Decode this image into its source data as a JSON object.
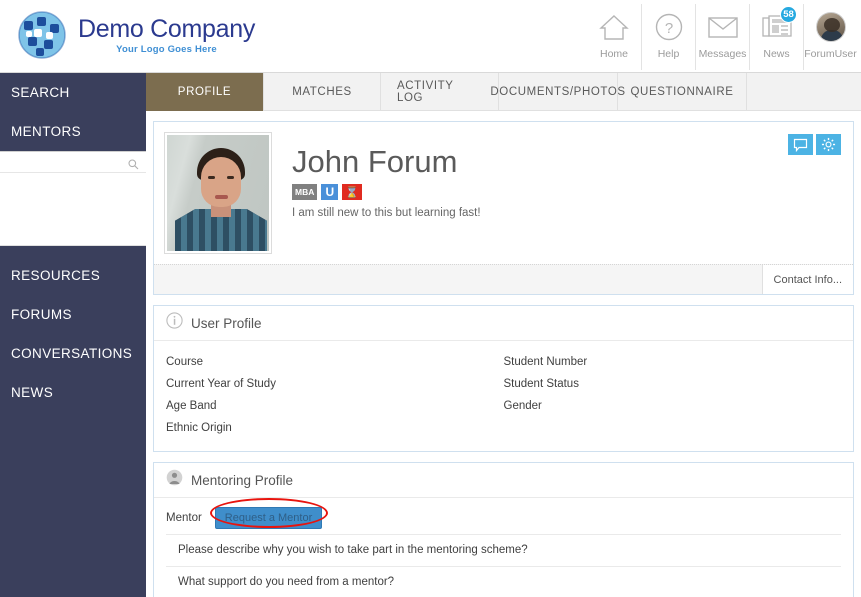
{
  "brand": {
    "title": "Demo Company",
    "subtitle": "Your Logo Goes Here",
    "logo_icon": "puzzle-globe-icon",
    "title_color": "#2b3a8f",
    "subtitle_color": "#3f8fd4"
  },
  "topnav": {
    "items": [
      {
        "label": "Home",
        "icon": "home-icon"
      },
      {
        "label": "Help",
        "icon": "help-question-icon"
      },
      {
        "label": "Messages",
        "icon": "envelope-icon"
      },
      {
        "label": "News",
        "icon": "newspaper-icon",
        "badge": "58"
      },
      {
        "label": "ForumUser",
        "icon": "user-avatar-icon"
      }
    ],
    "badge_color": "#26a9e0"
  },
  "sidebar": {
    "background_color": "#3a3f5c",
    "items_top": [
      {
        "label": "SEARCH"
      },
      {
        "label": "MENTORS"
      }
    ],
    "search": {
      "value": "",
      "placeholder": "",
      "icon": "search-icon"
    },
    "items_bottom": [
      {
        "label": "RESOURCES"
      },
      {
        "label": "FORUMS"
      },
      {
        "label": "CONVERSATIONS"
      },
      {
        "label": "NEWS"
      }
    ]
  },
  "tabs": {
    "active_color": "#7c6d4f",
    "items": [
      {
        "label": "PROFILE",
        "active": true
      },
      {
        "label": "MATCHES",
        "active": false
      },
      {
        "label": "ACTIVITY LOG",
        "active": false
      },
      {
        "label": "DOCUMENTS/PHOTOS",
        "active": false
      },
      {
        "label": "QUESTIONNAIRE",
        "active": false
      }
    ]
  },
  "profile": {
    "photo_icon": "user-photo",
    "name": "John Forum",
    "badges": [
      {
        "label": "MBA",
        "color": "#808080"
      },
      {
        "label": "U",
        "color": "#4a90d9"
      },
      {
        "label": "⌛",
        "color": "#e02b20"
      }
    ],
    "tagline": "I am still new to this but learning fast!",
    "actions": [
      {
        "icon": "chat-bubble-icon"
      },
      {
        "icon": "gear-icon"
      }
    ],
    "contact_tab_label": "Contact Info..."
  },
  "user_profile": {
    "section_title": "User Profile",
    "section_icon": "info-circle-icon",
    "fields": [
      {
        "label": "Course"
      },
      {
        "label": "Student Number"
      },
      {
        "label": "Current Year of Study"
      },
      {
        "label": "Student Status"
      },
      {
        "label": "Age Band"
      },
      {
        "label": "Gender"
      },
      {
        "label": "Ethnic Origin"
      }
    ]
  },
  "mentoring_profile": {
    "section_title": "Mentoring Profile",
    "section_icon": "person-circle-icon",
    "mentor_label": "Mentor",
    "request_button_label": "Request a Mentor",
    "request_button_color": "#3f8ecb",
    "annotation_color": "#e8140e",
    "questions": [
      {
        "text": "Please describe why you wish to take part in the mentoring scheme?"
      },
      {
        "text": "What support do you need from a mentor?"
      }
    ]
  }
}
